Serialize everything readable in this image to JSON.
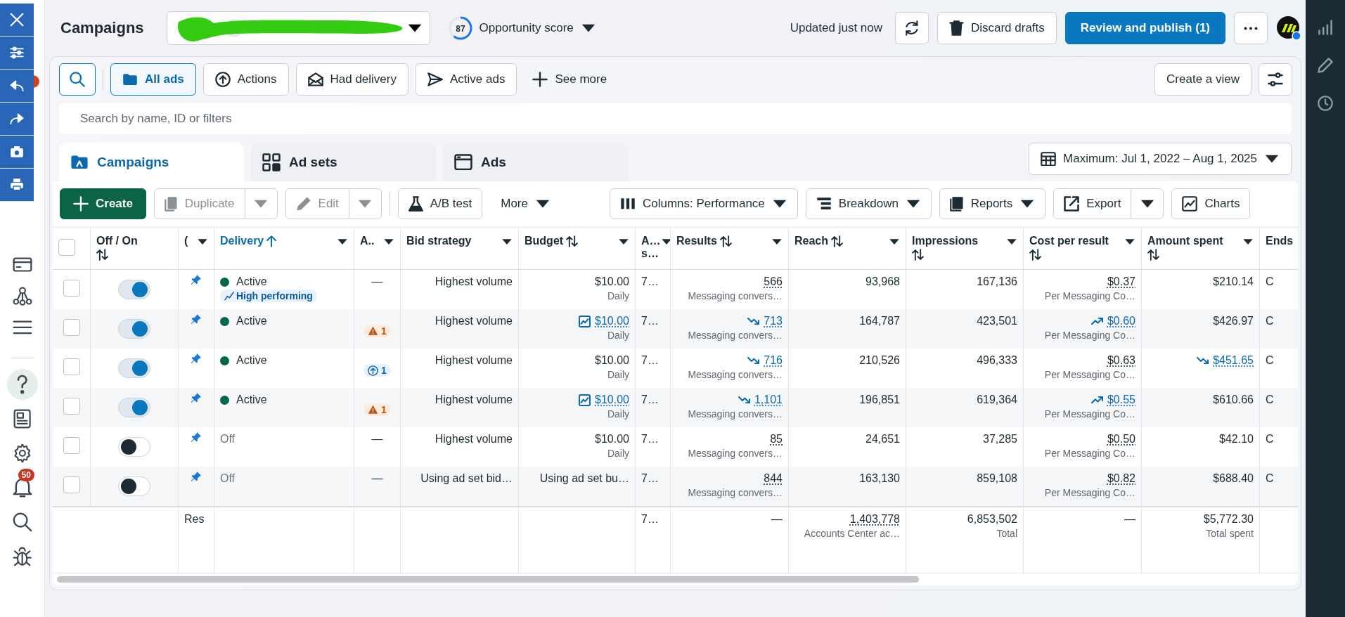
{
  "sidebar": {
    "notifications": "50"
  },
  "header": {
    "title": "Campaigns",
    "score": {
      "value": "87",
      "label": "Opportunity score"
    },
    "updated": "Updated just now",
    "discard": "Discard drafts",
    "publish": "Review and publish (1)"
  },
  "filters": {
    "items": [
      {
        "label": "All ads",
        "selected": true
      },
      {
        "label": "Actions",
        "selected": false
      },
      {
        "label": "Had delivery",
        "selected": false
      },
      {
        "label": "Active ads",
        "selected": false
      }
    ],
    "see_more": "See more",
    "create_view": "Create a view"
  },
  "search": {
    "placeholder": "Search by name, ID or filters"
  },
  "tabs": [
    {
      "label": "Campaigns",
      "selected": true
    },
    {
      "label": "Ad sets",
      "selected": false
    },
    {
      "label": "Ads",
      "selected": false
    }
  ],
  "date_range": "Maximum: Jul 1, 2022 – Aug 1, 2025",
  "toolbar": [
    {
      "label": "Create",
      "kind": "primary",
      "disabled": false
    },
    {
      "label": "Duplicate",
      "kind": "split",
      "disabled": true
    },
    {
      "label": "Edit",
      "kind": "split",
      "disabled": true
    },
    {
      "label": "A/B test",
      "kind": "plain",
      "disabled": false
    },
    {
      "label": "More",
      "kind": "menu",
      "disabled": false
    },
    {
      "label": "Columns: Performance",
      "kind": "dropdown",
      "disabled": false
    },
    {
      "label": "Breakdown",
      "kind": "dropdown",
      "disabled": false
    },
    {
      "label": "Reports",
      "kind": "dropdown",
      "disabled": false
    },
    {
      "label": "Export",
      "kind": "split",
      "disabled": false
    },
    {
      "label": "Charts",
      "kind": "plain",
      "disabled": false
    }
  ],
  "table": {
    "select_all": {
      "checked": false
    },
    "columns": [
      {
        "label": "Off / On",
        "sortable": true,
        "sorted": false,
        "menu": false
      },
      {
        "label": "(",
        "sortable": false,
        "sorted": false,
        "menu": true
      },
      {
        "label": "Delivery",
        "sortable": false,
        "sorted": true,
        "menu": true
      },
      {
        "label": "A..",
        "sortable": false,
        "sorted": false,
        "menu": true
      },
      {
        "label": "Bid strategy",
        "sortable": false,
        "sorted": false,
        "menu": true
      },
      {
        "label": "Budget",
        "sortable": true,
        "sorted": false,
        "menu": true
      },
      {
        "label": "A… s…",
        "sortable": false,
        "sorted": false,
        "menu": true
      },
      {
        "label": "Results",
        "sortable": true,
        "sorted": false,
        "menu": true
      },
      {
        "label": "Reach",
        "sortable": true,
        "sorted": false,
        "menu": true
      },
      {
        "label": "Impressions",
        "sortable": true,
        "sorted": false,
        "menu": true
      },
      {
        "label": "Cost per result",
        "sortable": true,
        "sorted": false,
        "menu": true
      },
      {
        "label": "Amount spent",
        "sortable": true,
        "sorted": false,
        "menu": true
      },
      {
        "label": "Ends",
        "sortable": false,
        "sorted": false,
        "menu": false
      }
    ],
    "rows": [
      {
        "selected": false,
        "on": true,
        "delivery": {
          "kind": "active",
          "text": "Active",
          "badge": "High performing"
        },
        "attention": {
          "kind": "none",
          "text": "—"
        },
        "bid": "Highest volume",
        "budget": {
          "text": "$10.00",
          "sub": "Daily",
          "link": false
        },
        "column_7": "7…",
        "results": {
          "text": "566",
          "sub": "Messaging convers…",
          "kind": "plain"
        },
        "reach": "93,968",
        "impressions": "167,136",
        "cost": {
          "text": "$0.37",
          "sub": "Per Messaging Co…",
          "kind": "plain"
        },
        "spent": {
          "text": "$210.14",
          "kind": "plain"
        },
        "ends": "C"
      },
      {
        "selected": false,
        "on": true,
        "delivery": {
          "kind": "active",
          "text": "Active"
        },
        "attention": {
          "kind": "warning",
          "text": "1"
        },
        "bid": "Highest volume",
        "budget": {
          "text": "$10.00",
          "sub": "Daily",
          "link": true
        },
        "column_7": "7…",
        "results": {
          "text": "713",
          "sub": "Messaging convers…",
          "kind": "falling"
        },
        "reach": "164,787",
        "impressions": "423,501",
        "cost": {
          "text": "$0.60",
          "sub": "Per Messaging Co…",
          "kind": "rising"
        },
        "spent": {
          "text": "$426.97",
          "kind": "plain"
        },
        "ends": "C"
      },
      {
        "selected": false,
        "on": true,
        "delivery": {
          "kind": "active",
          "text": "Active"
        },
        "attention": {
          "kind": "info",
          "text": "1"
        },
        "bid": "Highest volume",
        "budget": {
          "text": "$10.00",
          "sub": "Daily",
          "link": false
        },
        "column_7": "7…",
        "results": {
          "text": "716",
          "sub": "Messaging convers…",
          "kind": "falling"
        },
        "reach": "210,526",
        "impressions": "496,333",
        "cost": {
          "text": "$0.63",
          "sub": "Per Messaging Co…",
          "kind": "plain"
        },
        "spent": {
          "text": "$451.65",
          "kind": "falling"
        },
        "ends": "C"
      },
      {
        "selected": false,
        "on": true,
        "delivery": {
          "kind": "active",
          "text": "Active"
        },
        "attention": {
          "kind": "warning",
          "text": "1"
        },
        "bid": "Highest volume",
        "budget": {
          "text": "$10.00",
          "sub": "Daily",
          "link": true
        },
        "column_7": "7…",
        "results": {
          "text": "1,101",
          "sub": "Messaging convers…",
          "kind": "falling"
        },
        "reach": "196,851",
        "impressions": "619,364",
        "cost": {
          "text": "$0.55",
          "sub": "Per Messaging Co…",
          "kind": "rising"
        },
        "spent": {
          "text": "$610.66",
          "kind": "plain"
        },
        "ends": "C"
      },
      {
        "selected": false,
        "on": false,
        "delivery": {
          "kind": "off",
          "text": "Off"
        },
        "attention": {
          "kind": "none",
          "text": "—"
        },
        "bid": "Highest volume",
        "budget": {
          "text": "$10.00",
          "sub": "Daily",
          "link": false
        },
        "column_7": "7…",
        "results": {
          "text": "85",
          "sub": "Messaging convers…",
          "kind": "plain"
        },
        "reach": "24,651",
        "impressions": "37,285",
        "cost": {
          "text": "$0.50",
          "sub": "Per Messaging Co…",
          "kind": "plain"
        },
        "spent": {
          "text": "$42.10",
          "kind": "plain"
        },
        "ends": "C"
      },
      {
        "selected": false,
        "on": false,
        "delivery": {
          "kind": "off",
          "text": "Off"
        },
        "attention": {
          "kind": "none",
          "text": "—"
        },
        "bid": "Using ad set bid…",
        "budget": {
          "text": "Using ad set bu…",
          "link": false
        },
        "column_7": "7…",
        "results": {
          "text": "844",
          "sub": "Messaging convers…",
          "kind": "plain"
        },
        "reach": "163,130",
        "impressions": "859,108",
        "cost": {
          "text": "$0.82",
          "sub": "Per Messaging Co…",
          "kind": "plain"
        },
        "spent": {
          "text": "$688.40",
          "kind": "plain"
        },
        "ends": "C"
      }
    ],
    "footer": {
      "column_3": "Res",
      "column_7": "7…",
      "results": "—",
      "reach": {
        "text": "1,403,778",
        "sub": "Accounts Center ac…"
      },
      "impressions": {
        "text": "6,853,502",
        "sub": "Total"
      },
      "cost": "—",
      "spent": {
        "text": "$5,772.30",
        "sub": "Total spent"
      }
    }
  }
}
